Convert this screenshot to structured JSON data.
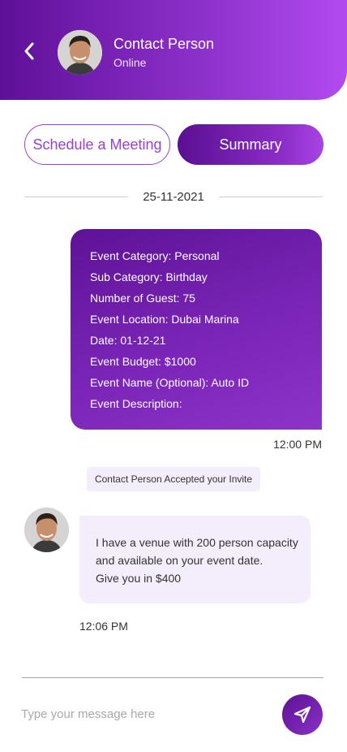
{
  "header": {
    "contact_name": "Contact Person",
    "status": "Online"
  },
  "tabs": {
    "schedule_label": "Schedule a Meeting",
    "summary_label": "Summary"
  },
  "date_divider": "25-11-2021",
  "summary_message": {
    "lines": [
      "Event Category: Personal",
      "Sub Category: Birthday",
      "Number of Guest: 75",
      "Event Location: Dubai Marina",
      "Date: 01-12-21",
      "Event Budget: $1000",
      "Event Name (Optional): Auto ID",
      "Event Description:"
    ],
    "time": "12:00 PM"
  },
  "system_note": "Contact Person Accepted your Invite",
  "incoming_message": {
    "lines": [
      "I have a venue with 200 person capacity",
      "and available on your event date.",
      "Give you in $400"
    ],
    "time": "12:06 PM"
  },
  "composer": {
    "placeholder": "Type your message here"
  },
  "colors": {
    "accent_dark": "#5e0f98",
    "accent_light": "#b24af0",
    "bubble_light": "#f4eefc"
  },
  "icons": {
    "back": "chevron-left-icon",
    "send": "send-icon"
  }
}
